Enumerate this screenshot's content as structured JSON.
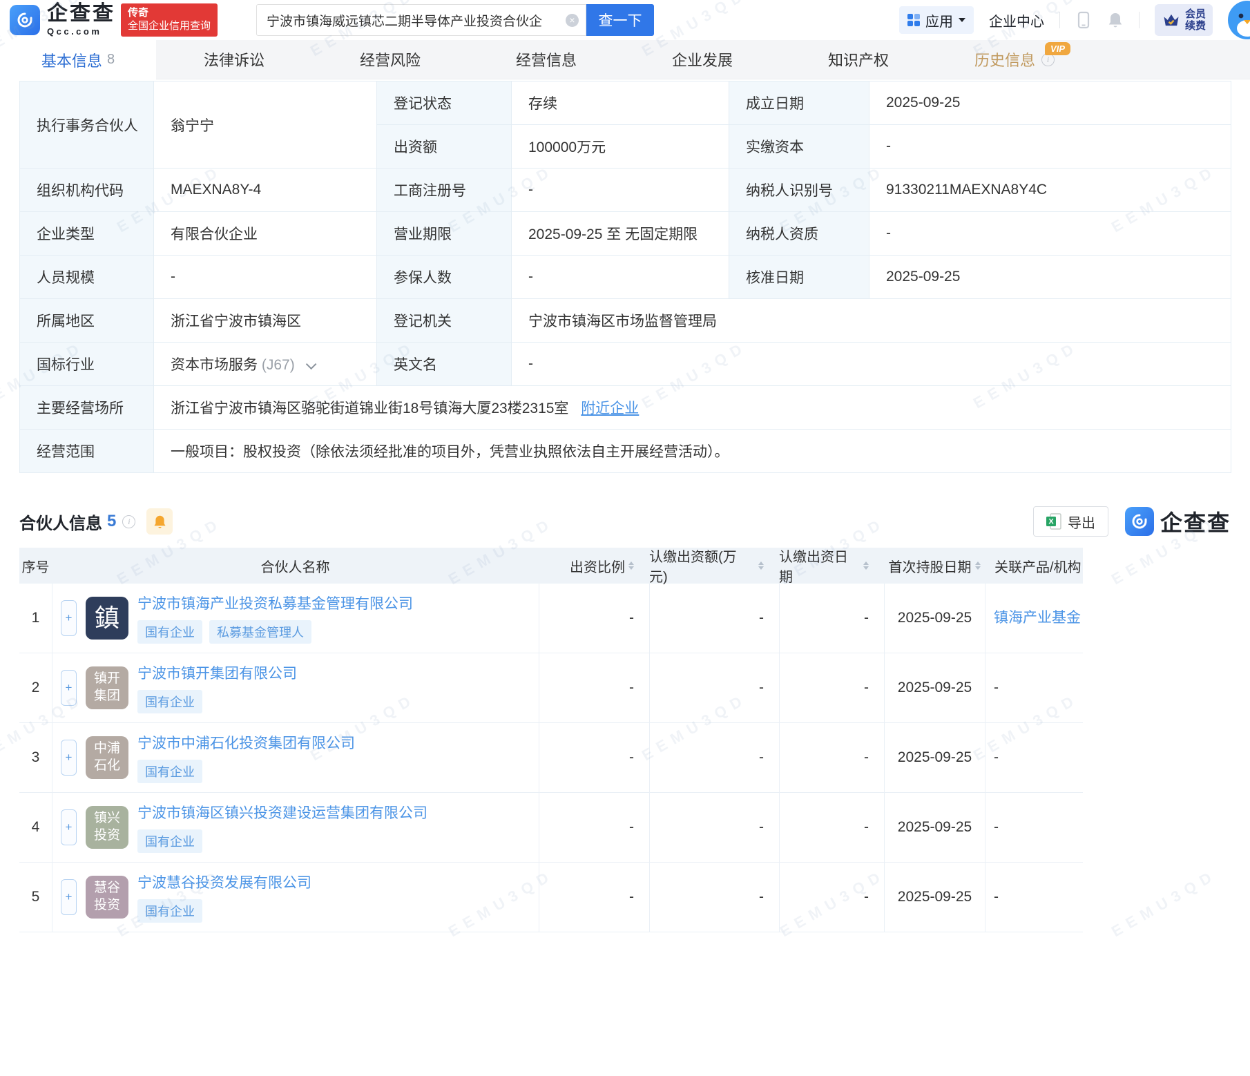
{
  "watermark": "EEMU3QD",
  "colors": {
    "brand_blue": "#2f7ceb",
    "link_blue": "#4b94e6",
    "active_tab_blue": "#2b6dd3",
    "badge_red": "#e23936",
    "history_gold": "#c19a5f",
    "vip_orange": "#f0a73f",
    "tag_bg": "#e9f3fc",
    "label_cell_bg": "#f2f8fc",
    "table_header_bg": "#eef3f8"
  },
  "header": {
    "logo_title": "企查查",
    "logo_subtitle": "Qcc.com",
    "badge_line1": "传奇",
    "badge_line2": "全国企业信用查询",
    "search_value": "宁波市镇海威远镇芯二期半导体产业投资合伙企",
    "search_button": "查一下",
    "nav_app": "应用",
    "nav_enterprise_center": "企业中心",
    "vip_renew_line1": "会员",
    "vip_renew_line2": "续费"
  },
  "tabs": {
    "items": [
      {
        "label": "基本信息",
        "count": "8"
      },
      {
        "label": "法律诉讼"
      },
      {
        "label": "经营风险"
      },
      {
        "label": "经营信息"
      },
      {
        "label": "企业发展"
      },
      {
        "label": "知识产权"
      },
      {
        "label": "历史信息",
        "vip": "VIP"
      }
    ]
  },
  "basic": {
    "exec": {
      "label": "执行事务合伙人",
      "value": "翁宁宁"
    },
    "reg_status": {
      "label": "登记状态",
      "value": "存续"
    },
    "est_date": {
      "label": "成立日期",
      "value": "2025-09-25"
    },
    "contribution": {
      "label": "出资额",
      "value": "100000万元"
    },
    "paid_in": {
      "label": "实缴资本",
      "value": "-"
    },
    "org_code": {
      "label": "组织机构代码",
      "value": "MAEXNA8Y-4"
    },
    "biz_reg_no": {
      "label": "工商注册号",
      "value": "-"
    },
    "taxpayer_no": {
      "label": "纳税人识别号",
      "value": "91330211MAEXNA8Y4C"
    },
    "ent_type": {
      "label": "企业类型",
      "value": "有限合伙企业"
    },
    "term": {
      "label": "营业期限",
      "value": "2025-09-25 至 无固定期限"
    },
    "taxpayer_quality": {
      "label": "纳税人资质",
      "value": "-"
    },
    "staff": {
      "label": "人员规模",
      "value": "-"
    },
    "insured": {
      "label": "参保人数",
      "value": "-"
    },
    "approval": {
      "label": "核准日期",
      "value": "2025-09-25"
    },
    "region": {
      "label": "所属地区",
      "value": "浙江省宁波市镇海区"
    },
    "authority": {
      "label": "登记机关",
      "value": "宁波市镇海区市场监督管理局"
    },
    "industry": {
      "label": "国标行业",
      "value": "资本市场服务",
      "code": "(J67)"
    },
    "english": {
      "label": "英文名",
      "value": "-"
    },
    "address": {
      "label": "主要经营场所",
      "value": "浙江省宁波市镇海区骆驼街道锦业街18号镇海大厦23楼2315室",
      "link": "附近企业"
    },
    "scope": {
      "label": "经营范围",
      "value": "一般项目：股权投资（除依法须经批准的项目外，凭营业执照依法自主开展经营活动）。"
    }
  },
  "partners": {
    "title": "合伙人信息",
    "count": "5",
    "export_label": "导出",
    "brand": "企查查",
    "columns": [
      {
        "label": "序号",
        "sortable": false
      },
      {
        "label": "合伙人名称",
        "sortable": false
      },
      {
        "label": "出资比例",
        "sortable": true
      },
      {
        "label": "认缴出资额(万元)",
        "sortable": true
      },
      {
        "label": "认缴出资日期",
        "sortable": true
      },
      {
        "label": "首次持股日期",
        "sortable": true
      },
      {
        "label": "关联产品/机构",
        "sortable": false
      }
    ],
    "rows": [
      {
        "no": "1",
        "name": "宁波市镇海产业投资私募基金管理有限公司",
        "logo_text": "鎮",
        "logo_color": "#2e3d5b",
        "tags": [
          "国有企业",
          "私募基金管理人"
        ],
        "ratio": "-",
        "amount": "-",
        "subscribe_date": "-",
        "first_hold_date": "2025-09-25",
        "related": "镇海产业基金"
      },
      {
        "no": "2",
        "name": "宁波市镇开集团有限公司",
        "logo_text": "镇开集团",
        "logo_color": "#b4aaa3",
        "tags": [
          "国有企业"
        ],
        "ratio": "-",
        "amount": "-",
        "subscribe_date": "-",
        "first_hold_date": "2025-09-25",
        "related": "-"
      },
      {
        "no": "3",
        "name": "宁波市中浦石化投资集团有限公司",
        "logo_text": "中浦石化",
        "logo_color": "#b4aaa3",
        "tags": [
          "国有企业"
        ],
        "ratio": "-",
        "amount": "-",
        "subscribe_date": "-",
        "first_hold_date": "2025-09-25",
        "related": "-"
      },
      {
        "no": "4",
        "name": "宁波市镇海区镇兴投资建设运营集团有限公司",
        "logo_text": "镇兴投资",
        "logo_color": "#a8b29e",
        "tags": [
          "国有企业"
        ],
        "ratio": "-",
        "amount": "-",
        "subscribe_date": "-",
        "first_hold_date": "2025-09-25",
        "related": "-"
      },
      {
        "no": "5",
        "name": "宁波慧谷投资发展有限公司",
        "logo_text": "慧谷投资",
        "logo_color": "#b39fad",
        "tags": [
          "国有企业"
        ],
        "ratio": "-",
        "amount": "-",
        "subscribe_date": "-",
        "first_hold_date": "2025-09-25",
        "related": "-"
      }
    ]
  }
}
